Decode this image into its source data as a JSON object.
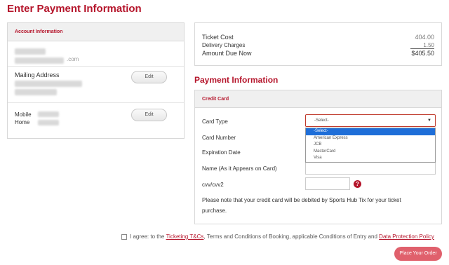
{
  "page": {
    "title": "Enter Payment Information"
  },
  "account": {
    "header": "Account Information",
    "email_suffix": ".com",
    "mailing_address_label": "Mailing Address",
    "edit_label": "Edit",
    "mobile_label": "Mobile",
    "home_label": "Home"
  },
  "costs": {
    "ticket_cost_label": "Ticket Cost",
    "ticket_cost_value": "404.00",
    "delivery_label": "Delivery Charges",
    "delivery_value": "1.50",
    "amount_due_label": "Amount Due Now",
    "amount_due_value": "$405.50"
  },
  "payment": {
    "title": "Payment Information",
    "card_header": "Credit Card",
    "card_type_label": "Card Type",
    "card_type_selected": "-Select-",
    "card_type_options": [
      "-Select-",
      "American Express",
      "JCB",
      "MasterCard",
      "Visa"
    ],
    "card_number_label": "Card Number",
    "expiration_label": "Expiration Date",
    "name_label": "Name (As it Appears on Card)",
    "cvv_label": "cvv/cvv2",
    "help_glyph": "?",
    "note": "Please note that your credit card will be debited by Sports Hub Tix for your ticket purchase."
  },
  "agreement": {
    "prefix": "I agree: to the ",
    "tc_link": "Ticketing T&Cs",
    "middle": ", Terms and Conditions of Booking, applicable Conditions of Entry and ",
    "dp_link": "Data Protection Policy"
  },
  "place_order_label": "Place Your Order",
  "colors": {
    "brand": "#b5152b",
    "button": "#e0606c",
    "highlight": "#1e6ed8"
  }
}
